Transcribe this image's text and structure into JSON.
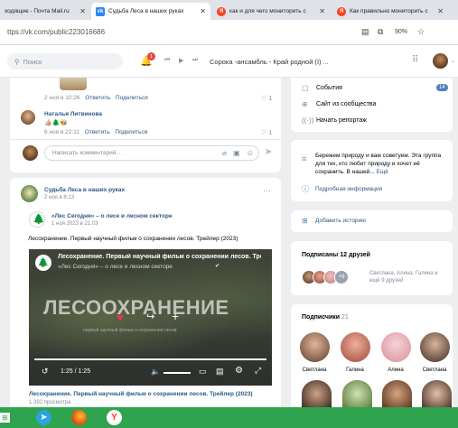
{
  "browser": {
    "tabs": [
      {
        "title": "ходящие - Почта Mail.ru",
        "icon": "mail-icon",
        "active": false
      },
      {
        "title": "Судьба Леса в наших руках",
        "icon": "vk-icon",
        "active": true
      },
      {
        "title": "как и для чего мониторить с",
        "icon": "yandex-icon",
        "active": false
      },
      {
        "title": "Как правильно мониторить с",
        "icon": "yandex-icon",
        "active": false
      }
    ],
    "url": "ttps://vk.com/public223016686",
    "zoom": "90%"
  },
  "header": {
    "search_placeholder": "Поиск",
    "notification_count": "1",
    "now_playing": "Сорока -ансамбль - Край родной (I) ..."
  },
  "post1": {
    "time": "2 ноя в 10:26",
    "reply": "Ответить",
    "share": "Поделиться",
    "likes": "1"
  },
  "comment": {
    "author": "Наталья Литвинова",
    "emojis": "👍🏼🌲🐝",
    "time": "6 ноя в 22:11",
    "reply": "Ответить",
    "share": "Поделиться",
    "likes": "1"
  },
  "comment_input": {
    "placeholder": "Написать комментарий..."
  },
  "post2": {
    "group_name": "Судьба Леса в наших руках",
    "time": "2 ноя в 8:13",
    "more": "···",
    "repost_source": "«Лес Сегодня» – о лесе и лесном секторе",
    "repost_time": "1 ноя 2023 в 21:03",
    "text": "Лесохранение. Первый научный фильм о сохранении лесов. Трейлер (2023)",
    "video": {
      "title": "Лесохранение. Первый научный фильм о сохранении лесов. Тре...",
      "channel": "«Лес Сегодня» – о лесе и лесном секторе",
      "overlay_big": "ЛЕСООХРАНЕНИЕ",
      "overlay_small": "первый научный фильм о сохранении лесов",
      "time": "1:25 / 1:25",
      "progress": 1.0
    },
    "caption": "Лесохранение. Первый научный фильм о сохранении лесов. Трейлер (2023)",
    "views": "1 392 просмотра"
  },
  "sidebar": {
    "menu": [
      {
        "label": "События",
        "badge": "14",
        "icon": "calendar-icon"
      },
      {
        "label": "Сайт из сообщества",
        "icon": "globe-icon"
      },
      {
        "label": "Начать репортаж",
        "icon": "broadcast-icon"
      }
    ],
    "about_text": "Бережем природу и вам советуем. Эта группа для тех, кто любит природу и хочет её сохранить. В нашей...",
    "about_more": "Ещё",
    "details_link": "Подробная информация",
    "add_story": "Добавить историю",
    "friends_title": "Подписаны 12 друзей",
    "friends_more": "+9",
    "friends_names": "Светлана, Алина, Галина и ещё 9 друзей",
    "subscribers_title": "Подписчики",
    "subscribers_count": "21",
    "subscribers": [
      "Светлана",
      "Галина",
      "Алина",
      "Светлана"
    ]
  },
  "colors": {
    "vk_blue": "#2a5885",
    "accent": "#5181b8",
    "taskbar": "#2fa34e"
  }
}
